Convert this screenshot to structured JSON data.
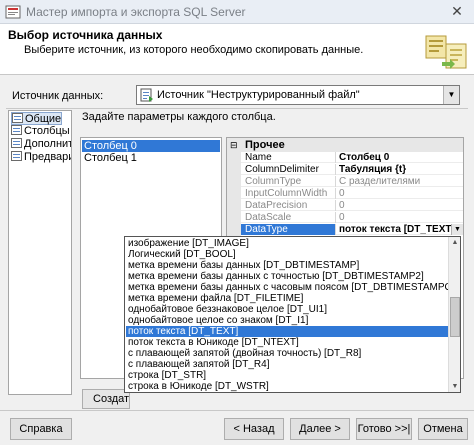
{
  "window": {
    "title": "Мастер импорта и экспорта SQL Server"
  },
  "header": {
    "title": "Выбор источника данных",
    "subtitle": "Выберите источник, из которого необходимо скопировать данные."
  },
  "datasource": {
    "label": "Источник данных:",
    "value": "Источник \"Неструктурированный файл\""
  },
  "nav": {
    "items": [
      {
        "label": "Общие",
        "selected": true
      },
      {
        "label": "Столбцы",
        "selected": false
      },
      {
        "label": "Дополните",
        "selected": false
      },
      {
        "label": "Предварит",
        "selected": false
      }
    ]
  },
  "main": {
    "instruction": "Задайте параметры каждого столбца.",
    "columns": [
      {
        "label": "Столбец 0",
        "selected": true
      },
      {
        "label": "Столбец 1",
        "selected": false
      }
    ]
  },
  "props": {
    "category": "Прочее",
    "toggle": "⊟",
    "rows": [
      {
        "name": "Name",
        "value": "Столбец 0"
      },
      {
        "name": "ColumnDelimiter",
        "value": "Табуляция {t}"
      },
      {
        "name": "ColumnType",
        "value": "С разделителями"
      },
      {
        "name": "InputColumnWidth",
        "value": "0"
      },
      {
        "name": "DataPrecision",
        "value": "0"
      },
      {
        "name": "DataScale",
        "value": "0"
      },
      {
        "name": "DataType",
        "value": "поток текста [DT_TEXT]"
      }
    ]
  },
  "dropdown": {
    "items": [
      "изображение [DT_IMAGE]",
      "Логический [DT_BOOL]",
      "метка времени базы данных [DT_DBTIMESTAMP]",
      "метка времени базы данных с точностью [DT_DBTIMESTAMP2]",
      "метка времени базы данных с часовым поясом [DT_DBTIMESTAMPOFFSET]",
      "метка времени файла [DT_FILETIME]",
      "однобайтовое беззнаковое целое [DT_UI1]",
      "однобайтовое целое со знаком [DT_I1]",
      "поток текста [DT_TEXT]",
      "поток текста в Юникоде [DT_NTEXT]",
      "с плавающей запятой (двойная точность) [DT_R8]",
      "с плавающей запятой [DT_R4]",
      "строка [DT_STR]",
      "строка в Юникоде [DT_WSTR]"
    ],
    "selected_index": 8
  },
  "buttons": {
    "create": "Создат",
    "help": "Справка",
    "back": "< Назад",
    "next": "Далее >",
    "finish": "Готово >>|",
    "cancel": "Отмена"
  },
  "colors": {
    "selection": "#3078d6",
    "title_text": "#7a7f86"
  },
  "icons": {
    "app": "sql-server-wizard-icon",
    "close": "close-icon",
    "wizard_art": "import-export-wizard-art",
    "datasource": "flat-file-source-icon"
  }
}
